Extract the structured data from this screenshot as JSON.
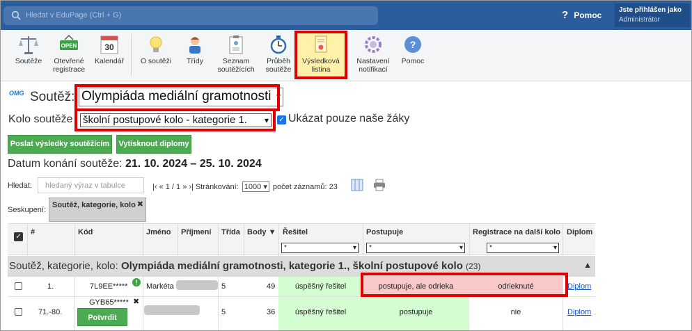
{
  "topbar": {
    "search_placeholder": "Hledat v EduPage (Ctrl + G)",
    "help_label": "Pomoc",
    "user_line1": "Jste přihlášen jako",
    "user_line2": "Administrátor"
  },
  "toolbar": {
    "items": [
      {
        "label": "Soutěže",
        "icon": "scales-icon"
      },
      {
        "label": "Otevřené\nregistrace",
        "icon": "open-sign-icon",
        "badge": "OPEN"
      },
      {
        "label": "Kalendář",
        "icon": "calendar-icon",
        "day": "30"
      },
      {
        "label": "O soutěži",
        "icon": "lightbulb-icon"
      },
      {
        "label": "Třídy",
        "icon": "student-icon"
      },
      {
        "label": "Seznam\nsoutěžících",
        "icon": "clipboard-icon"
      },
      {
        "label": "Průběh\nsoutěže",
        "icon": "stopwatch-icon"
      },
      {
        "label": "Výsledková\nlistina",
        "icon": "certificate-icon",
        "active": true
      },
      {
        "label": "Nastavení\nnotifikací",
        "icon": "gear-icon"
      },
      {
        "label": "Pomoc",
        "icon": "help-icon"
      }
    ]
  },
  "competition": {
    "logo": "OMG",
    "label": "Soutěž:",
    "selected": "Olympiáda mediální gramotnosti",
    "round_label": "Kolo soutěže",
    "round_selected": "školní postupové kolo - kategorie 1.",
    "only_ours_label": "Ukázat pouze naše žáky",
    "only_ours_checked": true,
    "btn_send": "Poslat výsledky soutěžícím",
    "btn_print": "Vytisknout diplomy",
    "date_label": "Datum konání soutěže:",
    "date_value": "21. 10. 2024 – 25. 10. 2024"
  },
  "filter": {
    "search_label": "Hledat:",
    "search_placeholder": "hledaný výraz v tabulce",
    "pager": "|‹ « 1 / 1 » ›|",
    "paging_label": "Stránkování:",
    "paging_value": "1000",
    "count_label": "počet záznamů: 23",
    "grouping_label": "Seskupení:",
    "grouping_chip": "Soutěž, kategorie, kolo"
  },
  "table": {
    "headers": {
      "num": "#",
      "code": "Kód",
      "first": "Jméno",
      "last": "Příjmení",
      "class": "Třída",
      "points": "Body",
      "solver": "Řešitel",
      "advances": "Postupuje",
      "registration": "Registrace na další kolo",
      "diploma": "Diplom"
    },
    "filter_value": "*",
    "group_label": "Soutěž, kategorie, kolo: ",
    "group_value": "Olympiáda mediální gramotnosti, kategorie 1., školní postupové kolo",
    "group_count": "(23)",
    "rows": [
      {
        "num": "1.",
        "code": "7L9EE*****",
        "first": "Markéta",
        "class": "5",
        "points": "49",
        "solver": "úspěšný řešitel",
        "advances": "postupuje, ale odrieka",
        "registration": "odrieknuté",
        "diploma": "Diplom"
      },
      {
        "num": "71.-80.",
        "code": "GYB65*****",
        "confirm": "Potvrdit účast",
        "class": "5",
        "points": "36",
        "solver": "úspěšný řešitel",
        "advances": "postupuje",
        "registration": "nie",
        "diploma": "Diplom"
      }
    ]
  }
}
